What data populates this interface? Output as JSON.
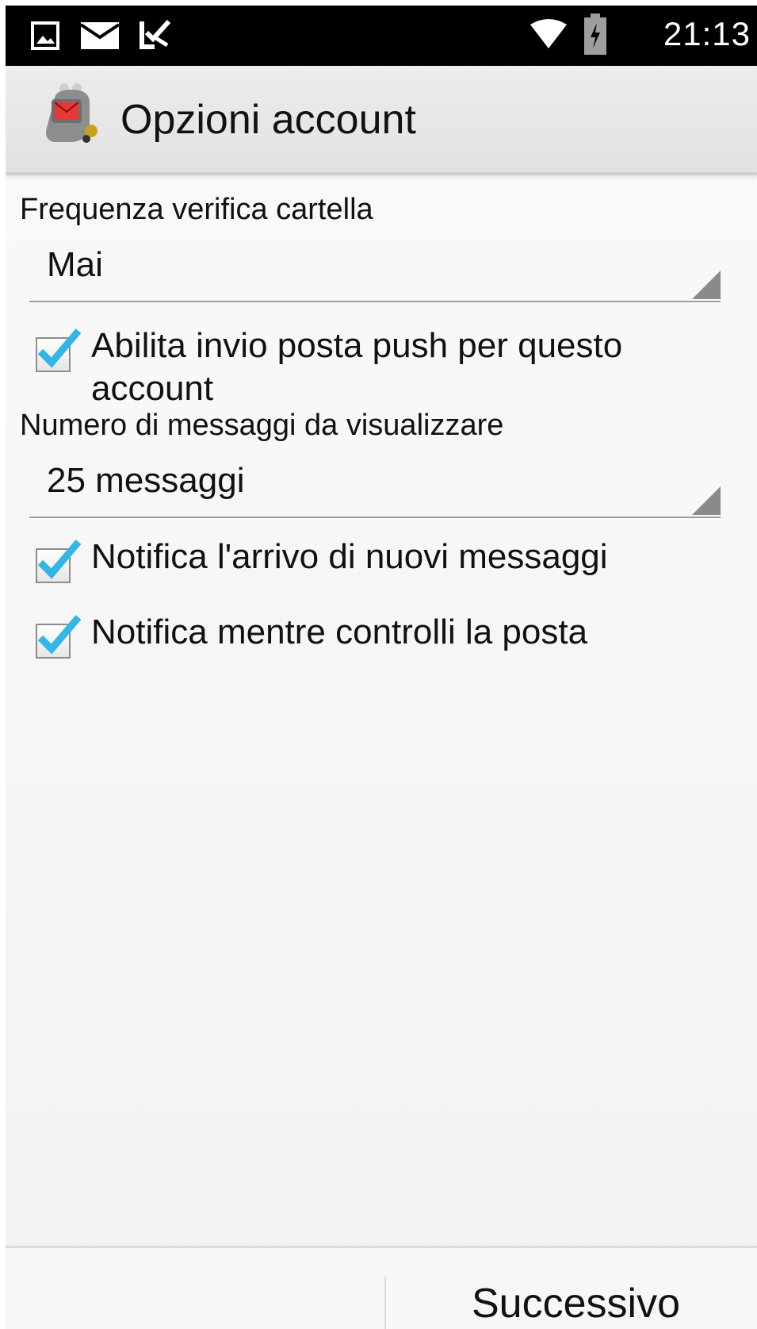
{
  "status_bar": {
    "time": "21:13",
    "icons": [
      "gallery-icon",
      "mail-icon",
      "task-icon",
      "wifi-icon",
      "battery-charging-icon"
    ]
  },
  "action_bar": {
    "title": "Opzioni account",
    "app_icon": "k9-mail-dog-icon"
  },
  "sections": {
    "frequency": {
      "label": "Frequenza verifica cartella",
      "value": "Mai"
    },
    "push": {
      "label": "Abilita invio posta push per questo account",
      "checked": true
    },
    "display_count": {
      "label": "Numero di messaggi da visualizzare",
      "value": "25 messaggi"
    },
    "notify_new": {
      "label": "Notifica l'arrivo di nuovi messaggi",
      "checked": true
    },
    "notify_check": {
      "label": "Notifica mentre controlli la posta",
      "checked": true
    }
  },
  "bottom_bar": {
    "next_label": "Successivo"
  },
  "colors": {
    "check_accent": "#33b5e5",
    "status_bar_bg": "#000000",
    "action_bar_bg": "#e6e6e6"
  }
}
